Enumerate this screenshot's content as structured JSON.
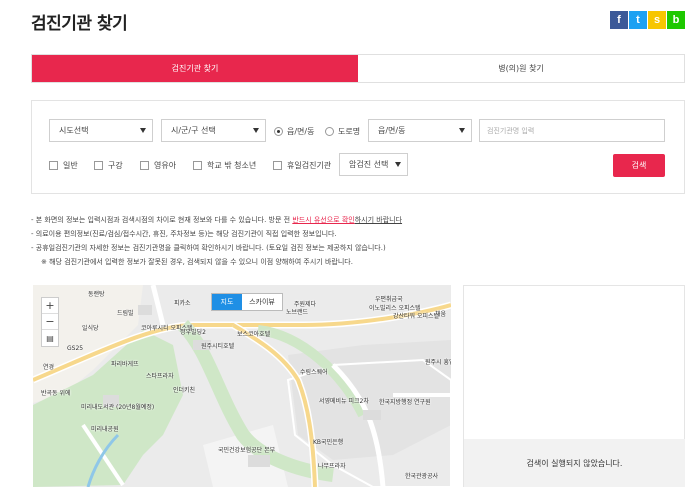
{
  "page": {
    "title": "검진기관 찾기"
  },
  "share": [
    {
      "icon": "facebook-icon",
      "glyph": "f",
      "color": "#3b5998"
    },
    {
      "icon": "twitter-icon",
      "glyph": "t",
      "color": "#1da1f2"
    },
    {
      "icon": "kakaostory-icon",
      "glyph": "s",
      "color": "#f7c600"
    },
    {
      "icon": "band-icon",
      "glyph": "b",
      "color": "#1ec800"
    }
  ],
  "tabs": [
    {
      "label": "검진기관 찾기",
      "active": true
    },
    {
      "label": "병(의)원 찾기",
      "active": false
    }
  ],
  "search": {
    "sido": "시도선택",
    "sigungu": "시/군/구 선택",
    "radio_dong": "읍/면/동",
    "radio_road": "도로명",
    "dong_select": "읍/면/동",
    "name_placeholder": "검진기관명 입력",
    "checkboxes": [
      "일반",
      "구강",
      "영유아",
      "학교 밖 청소년",
      "휴일검진기관"
    ],
    "cancer_select": "암검진 선택",
    "button": "검색"
  },
  "notes": {
    "line1_a": "- 본 화면의 정보는 입력시점과 검색시점의 차이로 현재 정보와 다를 수 있습니다.  방문 전 ",
    "line1_b": "반드시 유선으로 확인",
    "line1_c": "하시기 바랍니다",
    "line2": "- 의료이용 편의정보(진료/검심/접수시간, 휴진, 주차정보 등)는 해당 검진기관이 직접 입력한 정보입니다.",
    "line3": "- 공휴일검진기관의 자세한 정보는 검진기관명을 클릭하여 확인하시기 바랍니다. (토요일 검진 정보는 제공하지 않습니다.)",
    "line4": "※ 해당 검진기관에서 입력한 정보가 잘못된 경우, 검색되지 않을 수 있으니 이점 양해하여 주시기 바랍니다."
  },
  "map": {
    "type_map": "지도",
    "type_sky": "스카이뷰",
    "zoom_in": "+",
    "zoom_out": "−",
    "labels": [
      "동랜탕",
      "드림빌",
      "피카소",
      "주원제다",
      "노브랜드",
      "우편취급국",
      "이노빌리스 오피스텔",
      "오피스텔",
      "일식당",
      "코아루시티 오피스텔",
      "정우빌딩2",
      "보스코아호텔",
      "강산타워 오피스텔",
      "채움",
      "GS25",
      "파리바게뜨",
      "원주시티호텔",
      "원주시 흥업지",
      "연경",
      "스타프라자",
      "수림스퀘어",
      "인더키친",
      "반곡동 위에",
      "미리내도서관 (20년8월예정)",
      "서영메비뉴 피크2차",
      "한국지방행정 연구원",
      "미리내공원",
      "KB국민은행",
      "국민건강보험공단 본부",
      "나무프라자",
      "한국관광공사"
    ]
  },
  "results": {
    "empty_message": "검색이 실행되지 않았습니다."
  }
}
